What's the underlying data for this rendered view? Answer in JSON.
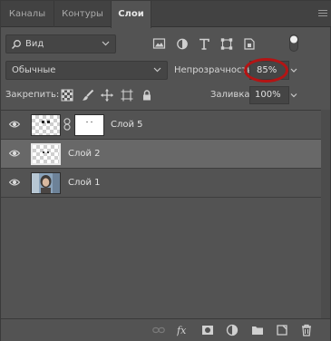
{
  "tabs": [
    {
      "label": "Каналы"
    },
    {
      "label": "Контуры"
    },
    {
      "label": "Слои"
    }
  ],
  "filter": {
    "label": "Вид"
  },
  "blend": {
    "mode": "Обычные"
  },
  "opacity": {
    "label": "Непрозрачность:",
    "value": "85%"
  },
  "lock": {
    "label": "Закрепить:"
  },
  "fill": {
    "label": "Заливка:",
    "value": "100%"
  },
  "layers": [
    {
      "name": "Слой 5",
      "selected": false
    },
    {
      "name": "Слой 2",
      "selected": true
    },
    {
      "name": "Слой 1",
      "selected": false
    }
  ],
  "colors": {
    "panel": "#535353",
    "selected_row": "#686868",
    "highlight_circle": "#b41414"
  }
}
